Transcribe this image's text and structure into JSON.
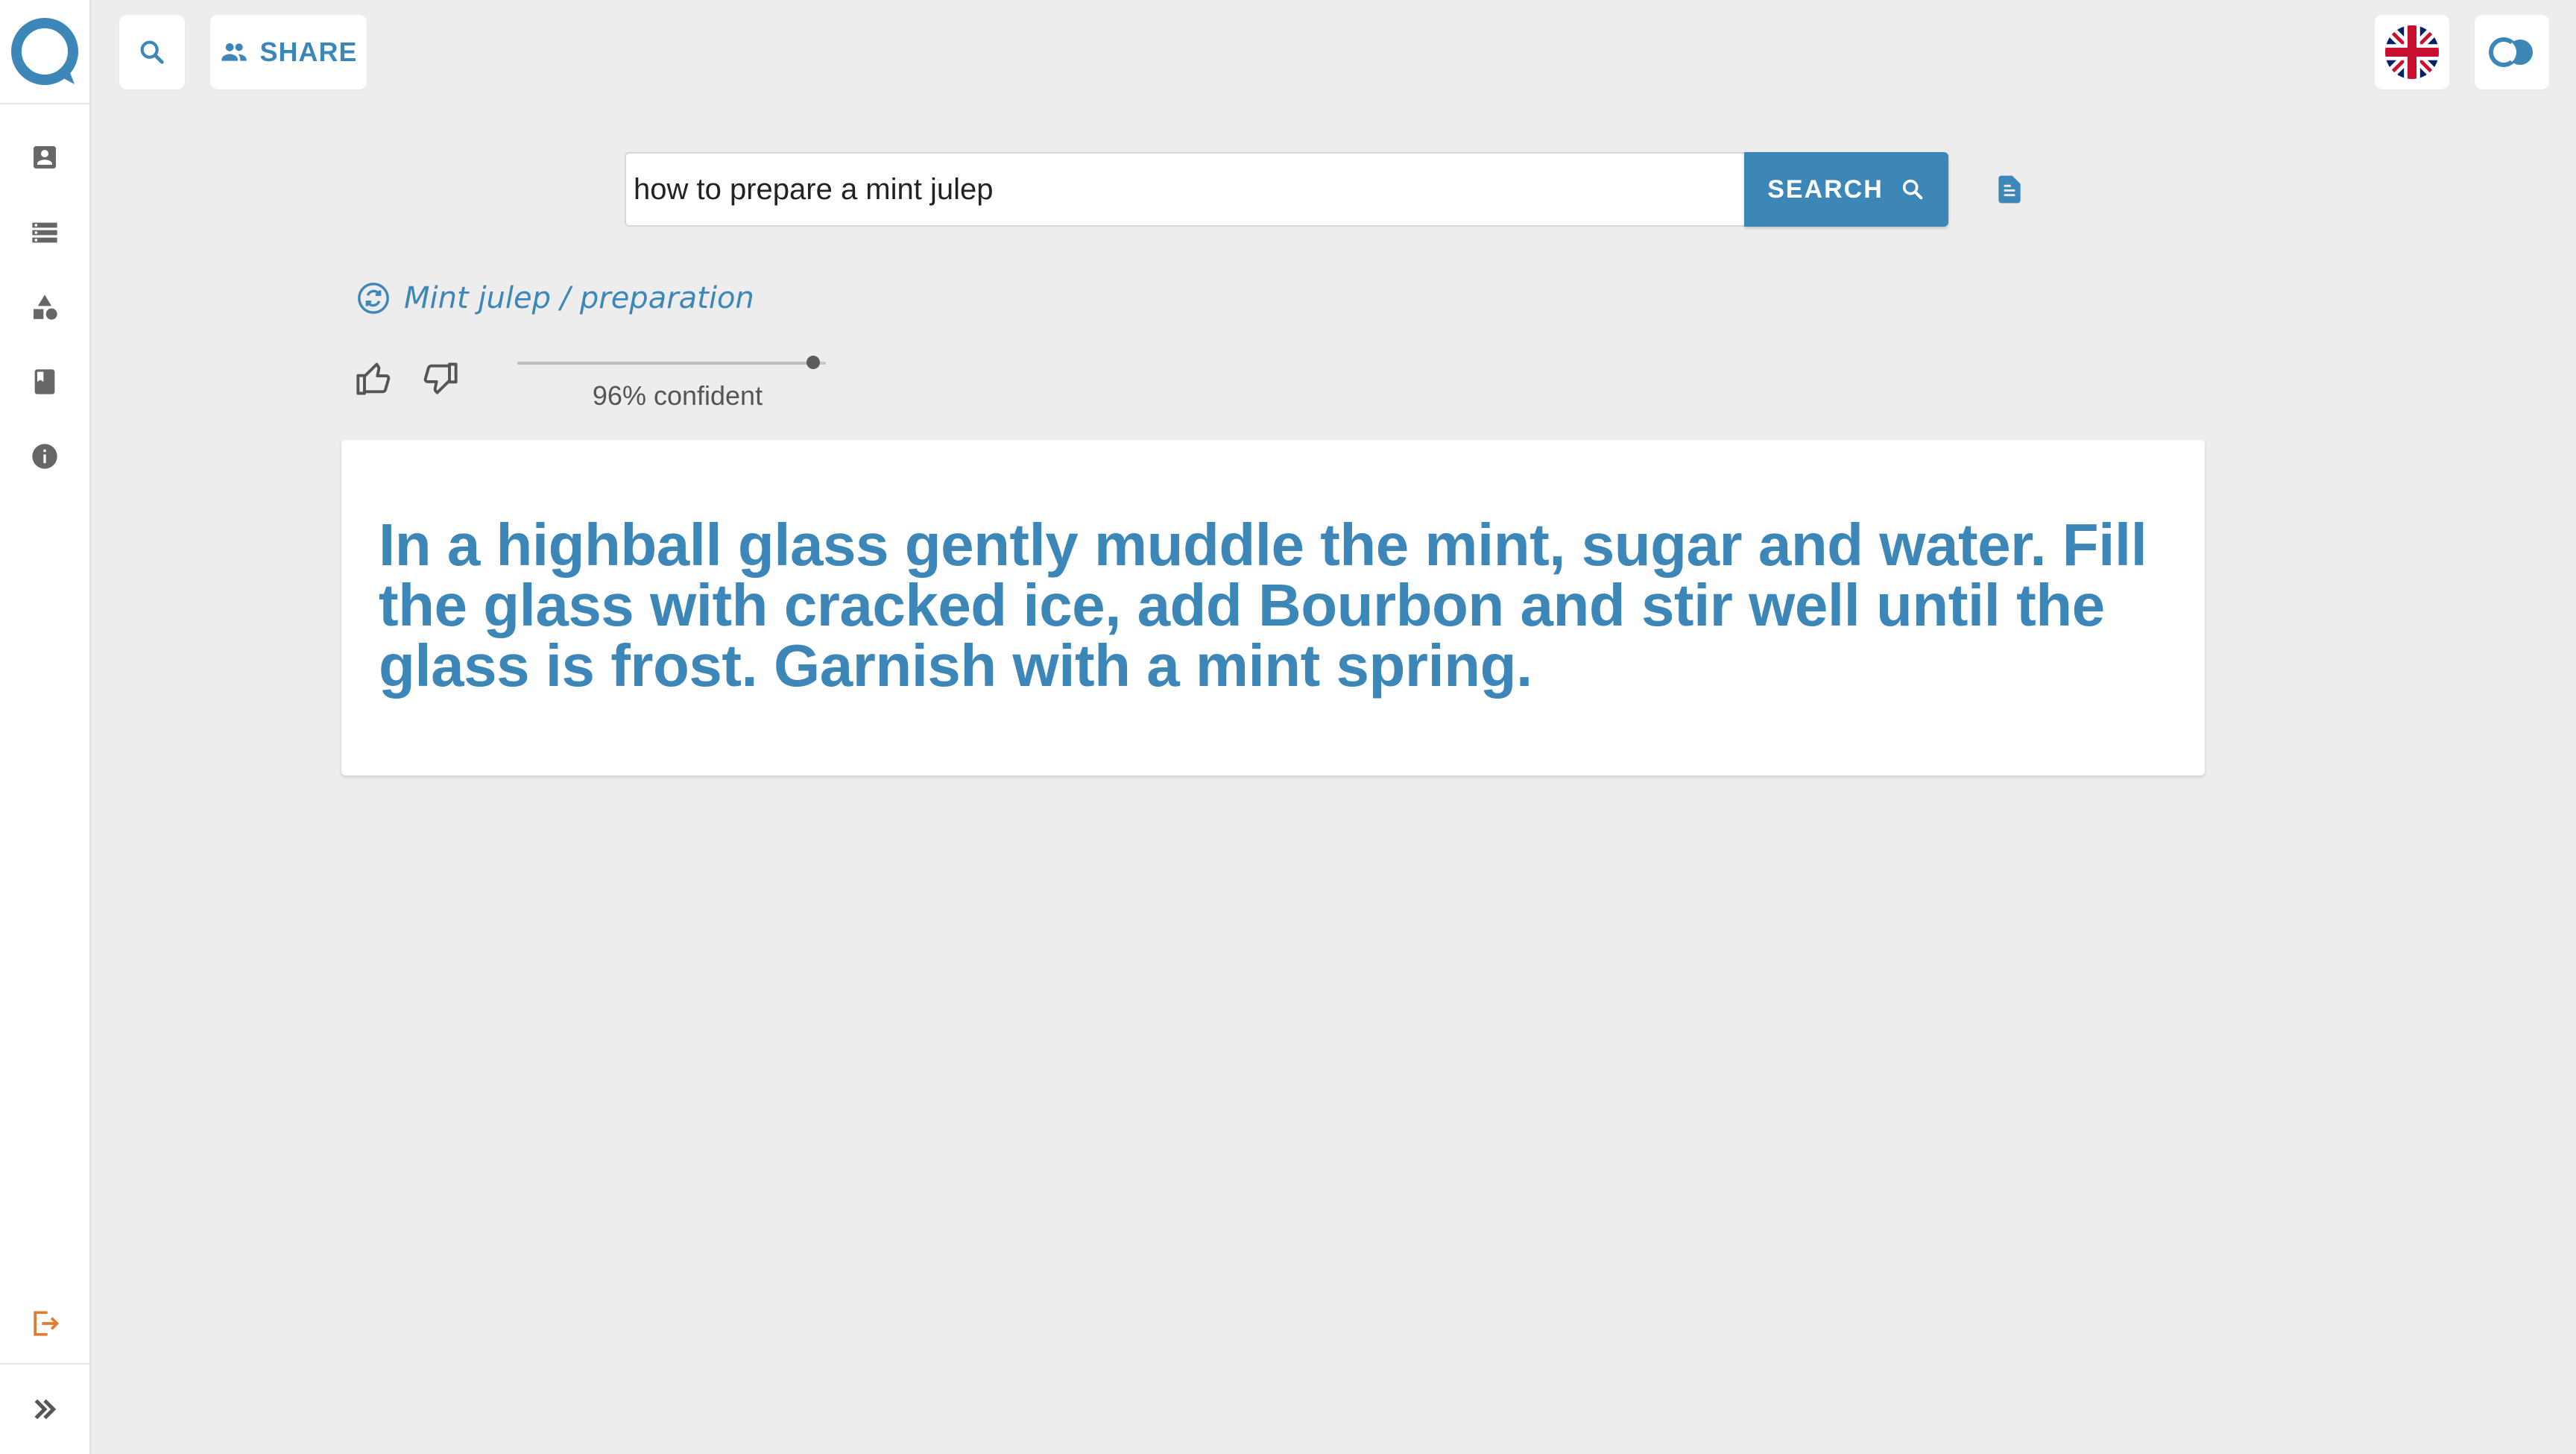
{
  "topbar": {
    "share_label": "SHARE",
    "language_icon": "uk-flag-icon",
    "brand_icon": "overlapping-circles-icon"
  },
  "sidebar": {
    "items": [
      {
        "icon": "account-box-icon"
      },
      {
        "icon": "storage-icon"
      },
      {
        "icon": "shapes-icon"
      },
      {
        "icon": "book-icon"
      },
      {
        "icon": "info-icon"
      }
    ],
    "logout_icon": "logout-icon",
    "expand_icon": "double-chevron-right-icon"
  },
  "search": {
    "query": "how to prepare a mint julep",
    "button_label": "SEARCH"
  },
  "result": {
    "breadcrumb": "Mint julep / preparation",
    "confidence": 0.96,
    "confidence_label": "96% confident",
    "answer": "In a highball glass gently muddle the mint, sugar and water. Fill the glass with cracked ice, add Bourbon and stir well until the glass is frost. Garnish with a mint spring."
  },
  "colors": {
    "accent": "#3d87b8",
    "logout": "#e07b2c",
    "background": "#ededed"
  }
}
